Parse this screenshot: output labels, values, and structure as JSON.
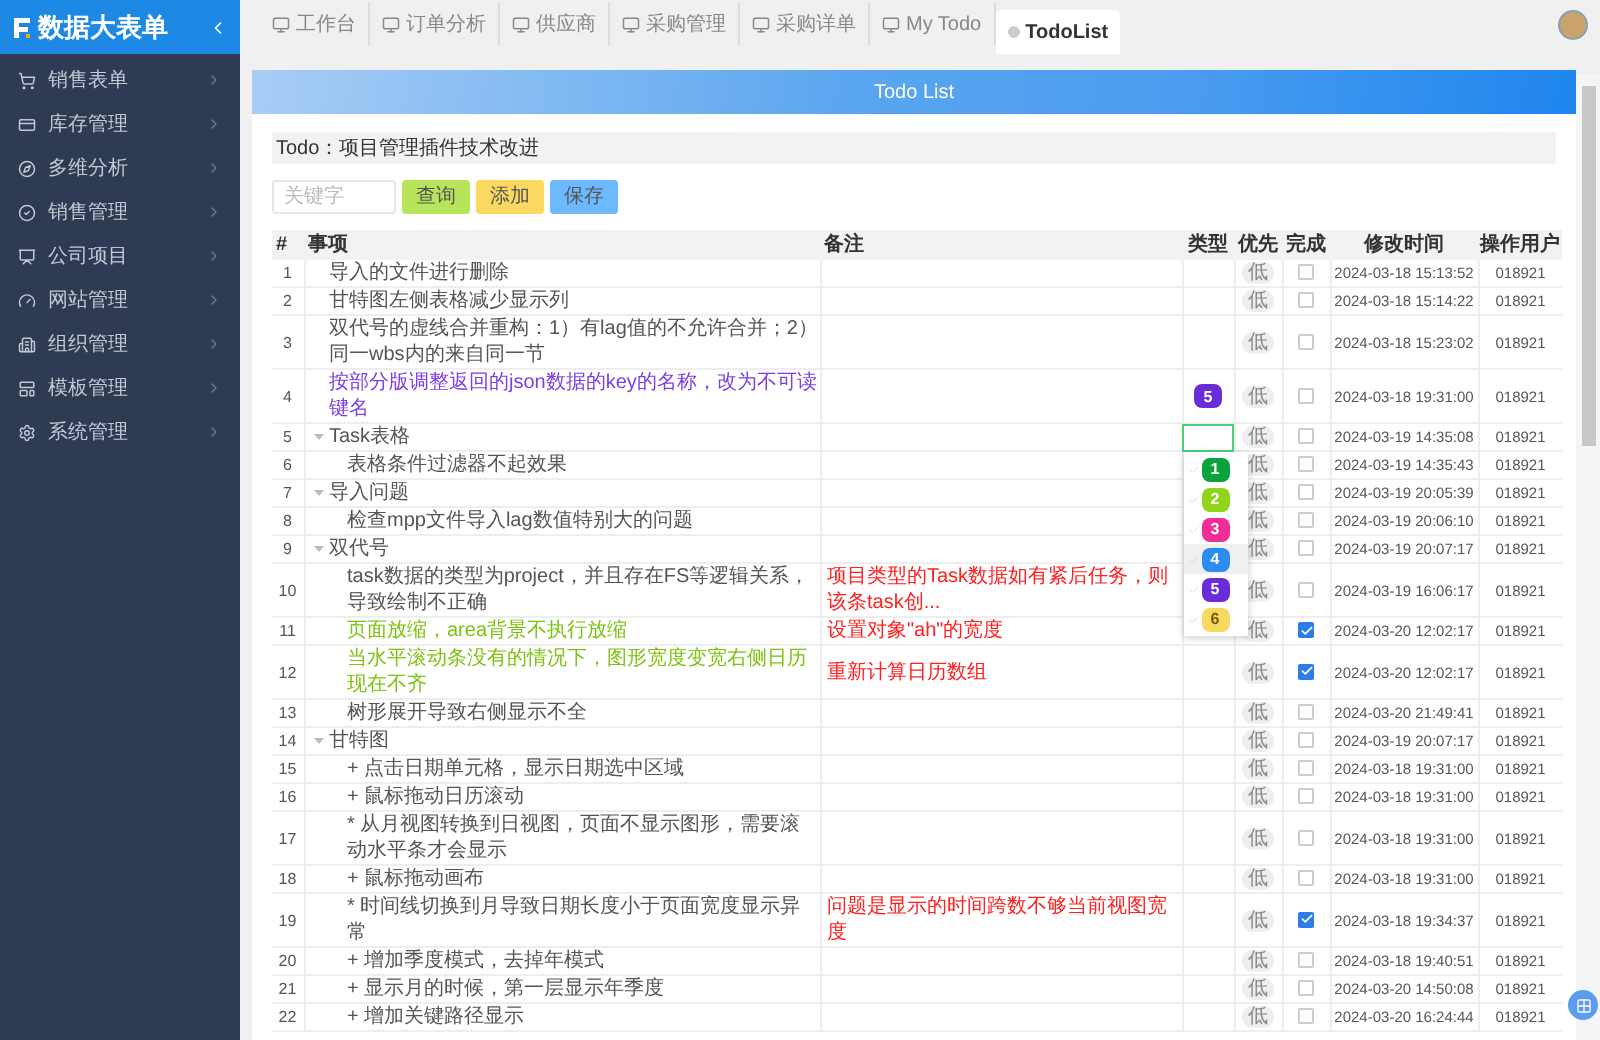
{
  "app": {
    "title": "数据大表单"
  },
  "sidebar": {
    "items": [
      {
        "label": "销售表单"
      },
      {
        "label": "库存管理"
      },
      {
        "label": "多维分析"
      },
      {
        "label": "销售管理"
      },
      {
        "label": "公司项目"
      },
      {
        "label": "网站管理"
      },
      {
        "label": "组织管理"
      },
      {
        "label": "模板管理"
      },
      {
        "label": "系统管理"
      }
    ]
  },
  "tabs": [
    {
      "label": "工作台",
      "selected": false
    },
    {
      "label": "订单分析",
      "selected": false
    },
    {
      "label": "供应商",
      "selected": false
    },
    {
      "label": "采购管理",
      "selected": false
    },
    {
      "label": "采购详单",
      "selected": false
    },
    {
      "label": "My Todo",
      "selected": false
    },
    {
      "label": "TodoList",
      "selected": true
    }
  ],
  "banner": {
    "title": "Todo List"
  },
  "section": {
    "title": "Todo：项目管理插件技术改进"
  },
  "toolbar": {
    "search": {
      "placeholder": "关键字"
    },
    "buttons": [
      {
        "label": "查询",
        "kind": "query"
      },
      {
        "label": "添加",
        "kind": "add"
      },
      {
        "label": "保存",
        "kind": "save"
      }
    ]
  },
  "table": {
    "columns": [
      "#",
      "事项",
      "备注",
      "类型",
      "优先",
      "完成",
      "修改时间",
      "操作用户"
    ],
    "rows": [
      {
        "num": "1",
        "text": "导入的文件进行删除",
        "color": "#555555",
        "priority": "低",
        "checked": false,
        "time": "2024-03-18 15:13:52",
        "user": "018921"
      },
      {
        "num": "2",
        "text": "甘特图左侧表格减少显示列",
        "color": "#555555",
        "priority": "低",
        "checked": false,
        "time": "2024-03-18 15:14:22",
        "user": "018921"
      },
      {
        "num": "3",
        "text": "双代号的虚线合并重构：1）有lag值的不允许合并；2）同一wbs内的来自同一节",
        "color": "#555555",
        "priority": "低",
        "checked": false,
        "time": "2024-03-18 15:23:02",
        "user": "018921"
      },
      {
        "num": "4",
        "text": "按部分版调整返回的json数据的key的名称，改为不可读键名",
        "color": "#7b3fe4",
        "type": {
          "label": "5",
          "color": "#6a2bd9"
        },
        "priority": "低",
        "checked": false,
        "time": "2024-03-18 19:31:00",
        "user": "018921"
      },
      {
        "num": "5",
        "text": "Task表格",
        "color": "#555555",
        "editing": true,
        "priority": "低",
        "checked": false,
        "time": "2024-03-19 14:35:08",
        "user": "018921",
        "expanded": true,
        "children": [
          {
            "num": "6",
            "text": "表格条件过滤器不起效果",
            "color": "#555555",
            "priority": "低",
            "checked": false,
            "time": "2024-03-19 14:35:43",
            "user": "018921"
          }
        ]
      },
      {
        "num": "7",
        "text": "导入问题",
        "color": "#555555",
        "priority": "低",
        "checked": false,
        "time": "2024-03-19 20:05:39",
        "user": "018921",
        "expanded": true,
        "children": [
          {
            "num": "8",
            "text": "检查mpp文件导入lag数值特别大的问题",
            "color": "#555555",
            "priority": "低",
            "checked": false,
            "time": "2024-03-19 20:06:10",
            "user": "018921"
          }
        ]
      },
      {
        "num": "9",
        "text": "双代号",
        "color": "#555555",
        "priority": "低",
        "checked": false,
        "time": "2024-03-19 20:07:17",
        "user": "018921",
        "expanded": true,
        "children": [
          {
            "num": "10",
            "text": "task数据的类型为project，并且存在FS等逻辑关系，导致绘制不正确",
            "color": "#555555",
            "note": "项目类型的Task数据如有紧后任务，则该条task创...",
            "priority": "低",
            "checked": false,
            "time": "2024-03-19 16:06:17",
            "user": "018921"
          },
          {
            "num": "11",
            "text": "页面放缩，area背景不执行放缩",
            "color": "#7cc20f",
            "note": "设置对象\"ah\"的宽度",
            "priority": "低",
            "checked": true,
            "time": "2024-03-20 12:02:17",
            "user": "018921"
          },
          {
            "num": "12",
            "text": "当水平滚动条没有的情况下，图形宽度变宽右侧日历现在不齐",
            "color": "#7cc20f",
            "note": "重新计算日历数组",
            "priority": "低",
            "checked": true,
            "time": "2024-03-20 12:02:17",
            "user": "018921"
          },
          {
            "num": "13",
            "text": "树形展开导致右侧显示不全",
            "color": "#555555",
            "priority": "低",
            "checked": false,
            "time": "2024-03-20 21:49:41",
            "user": "018921"
          }
        ]
      },
      {
        "num": "14",
        "text": "甘特图",
        "color": "#555555",
        "priority": "低",
        "checked": false,
        "time": "2024-03-19 20:07:17",
        "user": "018921",
        "expanded": true,
        "children": [
          {
            "num": "15",
            "text": "+ 点击日期单元格，显示日期选中区域",
            "color": "#555555",
            "priority": "低",
            "checked": false,
            "time": "2024-03-18 19:31:00",
            "user": "018921"
          },
          {
            "num": "16",
            "text": "+ 鼠标拖动日历滚动",
            "color": "#555555",
            "priority": "低",
            "checked": false,
            "time": "2024-03-18 19:31:00",
            "user": "018921"
          },
          {
            "num": "17",
            "text": "* 从月视图转换到日视图，页面不显示图形，需要滚动水平条才会显示",
            "color": "#555555",
            "priority": "低",
            "checked": false,
            "time": "2024-03-18 19:31:00",
            "user": "018921"
          },
          {
            "num": "18",
            "text": "+ 鼠标拖动画布",
            "color": "#555555",
            "priority": "低",
            "checked": false,
            "time": "2024-03-18 19:31:00",
            "user": "018921"
          },
          {
            "num": "19",
            "text": "* 时间线切换到月导致日期长度小于页面宽度显示异常",
            "color": "#555555",
            "note": "问题是显示的时间跨数不够当前视图宽度",
            "priority": "低",
            "checked": true,
            "time": "2024-03-18 19:34:37",
            "user": "018921"
          },
          {
            "num": "20",
            "text": "+ 增加季度模式，去掉年模式",
            "color": "#555555",
            "priority": "低",
            "checked": false,
            "time": "2024-03-18 19:40:51",
            "user": "018921"
          },
          {
            "num": "21",
            "text": "+ 显示月的时候，第一层显示年季度",
            "color": "#555555",
            "priority": "低",
            "checked": false,
            "time": "2024-03-20 14:50:08",
            "user": "018921"
          },
          {
            "num": "22",
            "text": "+ 增加关键路径显示",
            "color": "#555555",
            "priority": "低",
            "checked": false,
            "time": "2024-03-20 16:24:44",
            "user": "018921"
          }
        ]
      }
    ],
    "type_menu": {
      "options": [
        {
          "label": "1",
          "color": "#0aa33b",
          "selected": false
        },
        {
          "label": "2",
          "color": "#8fd41b",
          "selected": false
        },
        {
          "label": "3",
          "color": "#ee2e96",
          "selected": false
        },
        {
          "label": "4",
          "color": "#2d8cf0",
          "selected": true
        },
        {
          "label": "5",
          "color": "#6a2bd9",
          "selected": false
        },
        {
          "label": "6",
          "color": "#f7d861",
          "selected": false
        }
      ]
    }
  }
}
